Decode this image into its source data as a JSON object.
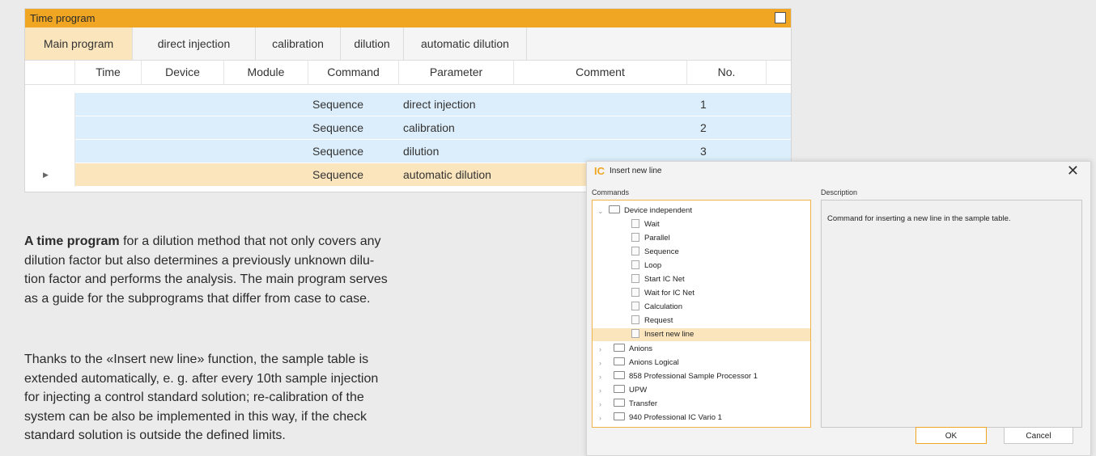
{
  "time_program": {
    "title": "Time program",
    "tabs": [
      {
        "label": "Main program"
      },
      {
        "label": "direct injection"
      },
      {
        "label": "calibration"
      },
      {
        "label": "dilution"
      },
      {
        "label": "automatic dilution"
      }
    ],
    "columns": [
      "Time",
      "Device",
      "Module",
      "Command",
      "Parameter",
      "Comment",
      "No."
    ],
    "rows": [
      {
        "command": "Sequence",
        "parameter": "direct injection",
        "no": "1"
      },
      {
        "command": "Sequence",
        "parameter": "calibration",
        "no": "2"
      },
      {
        "command": "Sequence",
        "parameter": "dilution",
        "no": "3"
      },
      {
        "command": "Sequence",
        "parameter": "automatic dilution",
        "no": ""
      }
    ]
  },
  "text": {
    "p1_bold": "A time program",
    "p1_line1_rest": " for a dilution method that not only covers any",
    "p1_line2": "dilution factor but also determines a previously unknown dilu-",
    "p1_line3": "tion factor and performs the analysis. The main program serves",
    "p1_line4": "as a guide for the subprograms that differ from case to case.",
    "p2_line1": "Thanks to the «Insert new line» function, the sample table is",
    "p2_line2": "extended automatically, e. g. after every 10th sample injection",
    "p2_line3": "for injecting a control standard solution; re-calibration of the",
    "p2_line4": "system can be also be implemented in this way, if the check",
    "p2_line5": "standard solution is outside the defined limits."
  },
  "dialog": {
    "logo": "IC",
    "title": "Insert new line",
    "close": "✕",
    "commands_label": "Commands",
    "description_label": "Description",
    "description": "Command for inserting a new line in the sample table.",
    "root": "Device independent",
    "children": [
      "Wait",
      "Parallel",
      "Sequence",
      "Loop",
      "Start IC Net",
      "Wait for IC Net",
      "Calculation",
      "Request",
      "Insert new line"
    ],
    "groups": [
      "Anions",
      "Anions Logical",
      "858 Professional Sample Processor 1",
      "UPW",
      "Transfer",
      "940 Professional IC Vario 1"
    ],
    "ok": "OK",
    "cancel": "Cancel"
  },
  "colors": {
    "accent": "#f0a623",
    "row_blue": "#dceefb",
    "row_selected": "#fbe5bd"
  }
}
